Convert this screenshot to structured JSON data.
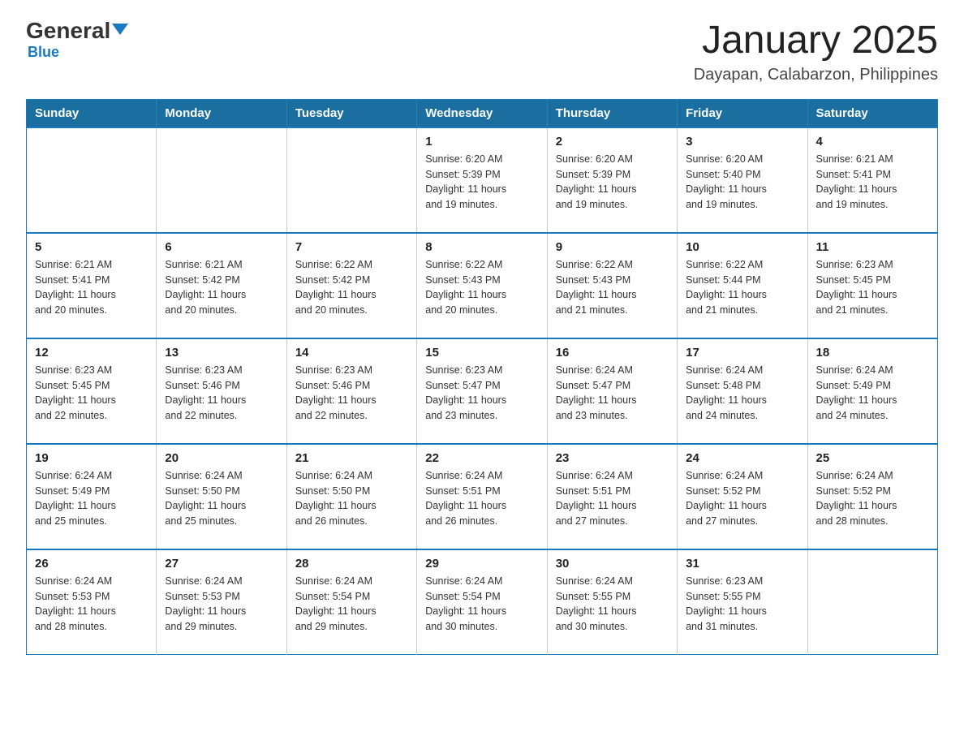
{
  "header": {
    "logo_general": "General",
    "logo_blue": "Blue",
    "title": "January 2025",
    "subtitle": "Dayapan, Calabarzon, Philippines"
  },
  "calendar": {
    "days_of_week": [
      "Sunday",
      "Monday",
      "Tuesday",
      "Wednesday",
      "Thursday",
      "Friday",
      "Saturday"
    ],
    "weeks": [
      [
        {
          "day": "",
          "info": ""
        },
        {
          "day": "",
          "info": ""
        },
        {
          "day": "",
          "info": ""
        },
        {
          "day": "1",
          "info": "Sunrise: 6:20 AM\nSunset: 5:39 PM\nDaylight: 11 hours\nand 19 minutes."
        },
        {
          "day": "2",
          "info": "Sunrise: 6:20 AM\nSunset: 5:39 PM\nDaylight: 11 hours\nand 19 minutes."
        },
        {
          "day": "3",
          "info": "Sunrise: 6:20 AM\nSunset: 5:40 PM\nDaylight: 11 hours\nand 19 minutes."
        },
        {
          "day": "4",
          "info": "Sunrise: 6:21 AM\nSunset: 5:41 PM\nDaylight: 11 hours\nand 19 minutes."
        }
      ],
      [
        {
          "day": "5",
          "info": "Sunrise: 6:21 AM\nSunset: 5:41 PM\nDaylight: 11 hours\nand 20 minutes."
        },
        {
          "day": "6",
          "info": "Sunrise: 6:21 AM\nSunset: 5:42 PM\nDaylight: 11 hours\nand 20 minutes."
        },
        {
          "day": "7",
          "info": "Sunrise: 6:22 AM\nSunset: 5:42 PM\nDaylight: 11 hours\nand 20 minutes."
        },
        {
          "day": "8",
          "info": "Sunrise: 6:22 AM\nSunset: 5:43 PM\nDaylight: 11 hours\nand 20 minutes."
        },
        {
          "day": "9",
          "info": "Sunrise: 6:22 AM\nSunset: 5:43 PM\nDaylight: 11 hours\nand 21 minutes."
        },
        {
          "day": "10",
          "info": "Sunrise: 6:22 AM\nSunset: 5:44 PM\nDaylight: 11 hours\nand 21 minutes."
        },
        {
          "day": "11",
          "info": "Sunrise: 6:23 AM\nSunset: 5:45 PM\nDaylight: 11 hours\nand 21 minutes."
        }
      ],
      [
        {
          "day": "12",
          "info": "Sunrise: 6:23 AM\nSunset: 5:45 PM\nDaylight: 11 hours\nand 22 minutes."
        },
        {
          "day": "13",
          "info": "Sunrise: 6:23 AM\nSunset: 5:46 PM\nDaylight: 11 hours\nand 22 minutes."
        },
        {
          "day": "14",
          "info": "Sunrise: 6:23 AM\nSunset: 5:46 PM\nDaylight: 11 hours\nand 22 minutes."
        },
        {
          "day": "15",
          "info": "Sunrise: 6:23 AM\nSunset: 5:47 PM\nDaylight: 11 hours\nand 23 minutes."
        },
        {
          "day": "16",
          "info": "Sunrise: 6:24 AM\nSunset: 5:47 PM\nDaylight: 11 hours\nand 23 minutes."
        },
        {
          "day": "17",
          "info": "Sunrise: 6:24 AM\nSunset: 5:48 PM\nDaylight: 11 hours\nand 24 minutes."
        },
        {
          "day": "18",
          "info": "Sunrise: 6:24 AM\nSunset: 5:49 PM\nDaylight: 11 hours\nand 24 minutes."
        }
      ],
      [
        {
          "day": "19",
          "info": "Sunrise: 6:24 AM\nSunset: 5:49 PM\nDaylight: 11 hours\nand 25 minutes."
        },
        {
          "day": "20",
          "info": "Sunrise: 6:24 AM\nSunset: 5:50 PM\nDaylight: 11 hours\nand 25 minutes."
        },
        {
          "day": "21",
          "info": "Sunrise: 6:24 AM\nSunset: 5:50 PM\nDaylight: 11 hours\nand 26 minutes."
        },
        {
          "day": "22",
          "info": "Sunrise: 6:24 AM\nSunset: 5:51 PM\nDaylight: 11 hours\nand 26 minutes."
        },
        {
          "day": "23",
          "info": "Sunrise: 6:24 AM\nSunset: 5:51 PM\nDaylight: 11 hours\nand 27 minutes."
        },
        {
          "day": "24",
          "info": "Sunrise: 6:24 AM\nSunset: 5:52 PM\nDaylight: 11 hours\nand 27 minutes."
        },
        {
          "day": "25",
          "info": "Sunrise: 6:24 AM\nSunset: 5:52 PM\nDaylight: 11 hours\nand 28 minutes."
        }
      ],
      [
        {
          "day": "26",
          "info": "Sunrise: 6:24 AM\nSunset: 5:53 PM\nDaylight: 11 hours\nand 28 minutes."
        },
        {
          "day": "27",
          "info": "Sunrise: 6:24 AM\nSunset: 5:53 PM\nDaylight: 11 hours\nand 29 minutes."
        },
        {
          "day": "28",
          "info": "Sunrise: 6:24 AM\nSunset: 5:54 PM\nDaylight: 11 hours\nand 29 minutes."
        },
        {
          "day": "29",
          "info": "Sunrise: 6:24 AM\nSunset: 5:54 PM\nDaylight: 11 hours\nand 30 minutes."
        },
        {
          "day": "30",
          "info": "Sunrise: 6:24 AM\nSunset: 5:55 PM\nDaylight: 11 hours\nand 30 minutes."
        },
        {
          "day": "31",
          "info": "Sunrise: 6:23 AM\nSunset: 5:55 PM\nDaylight: 11 hours\nand 31 minutes."
        },
        {
          "day": "",
          "info": ""
        }
      ]
    ]
  }
}
